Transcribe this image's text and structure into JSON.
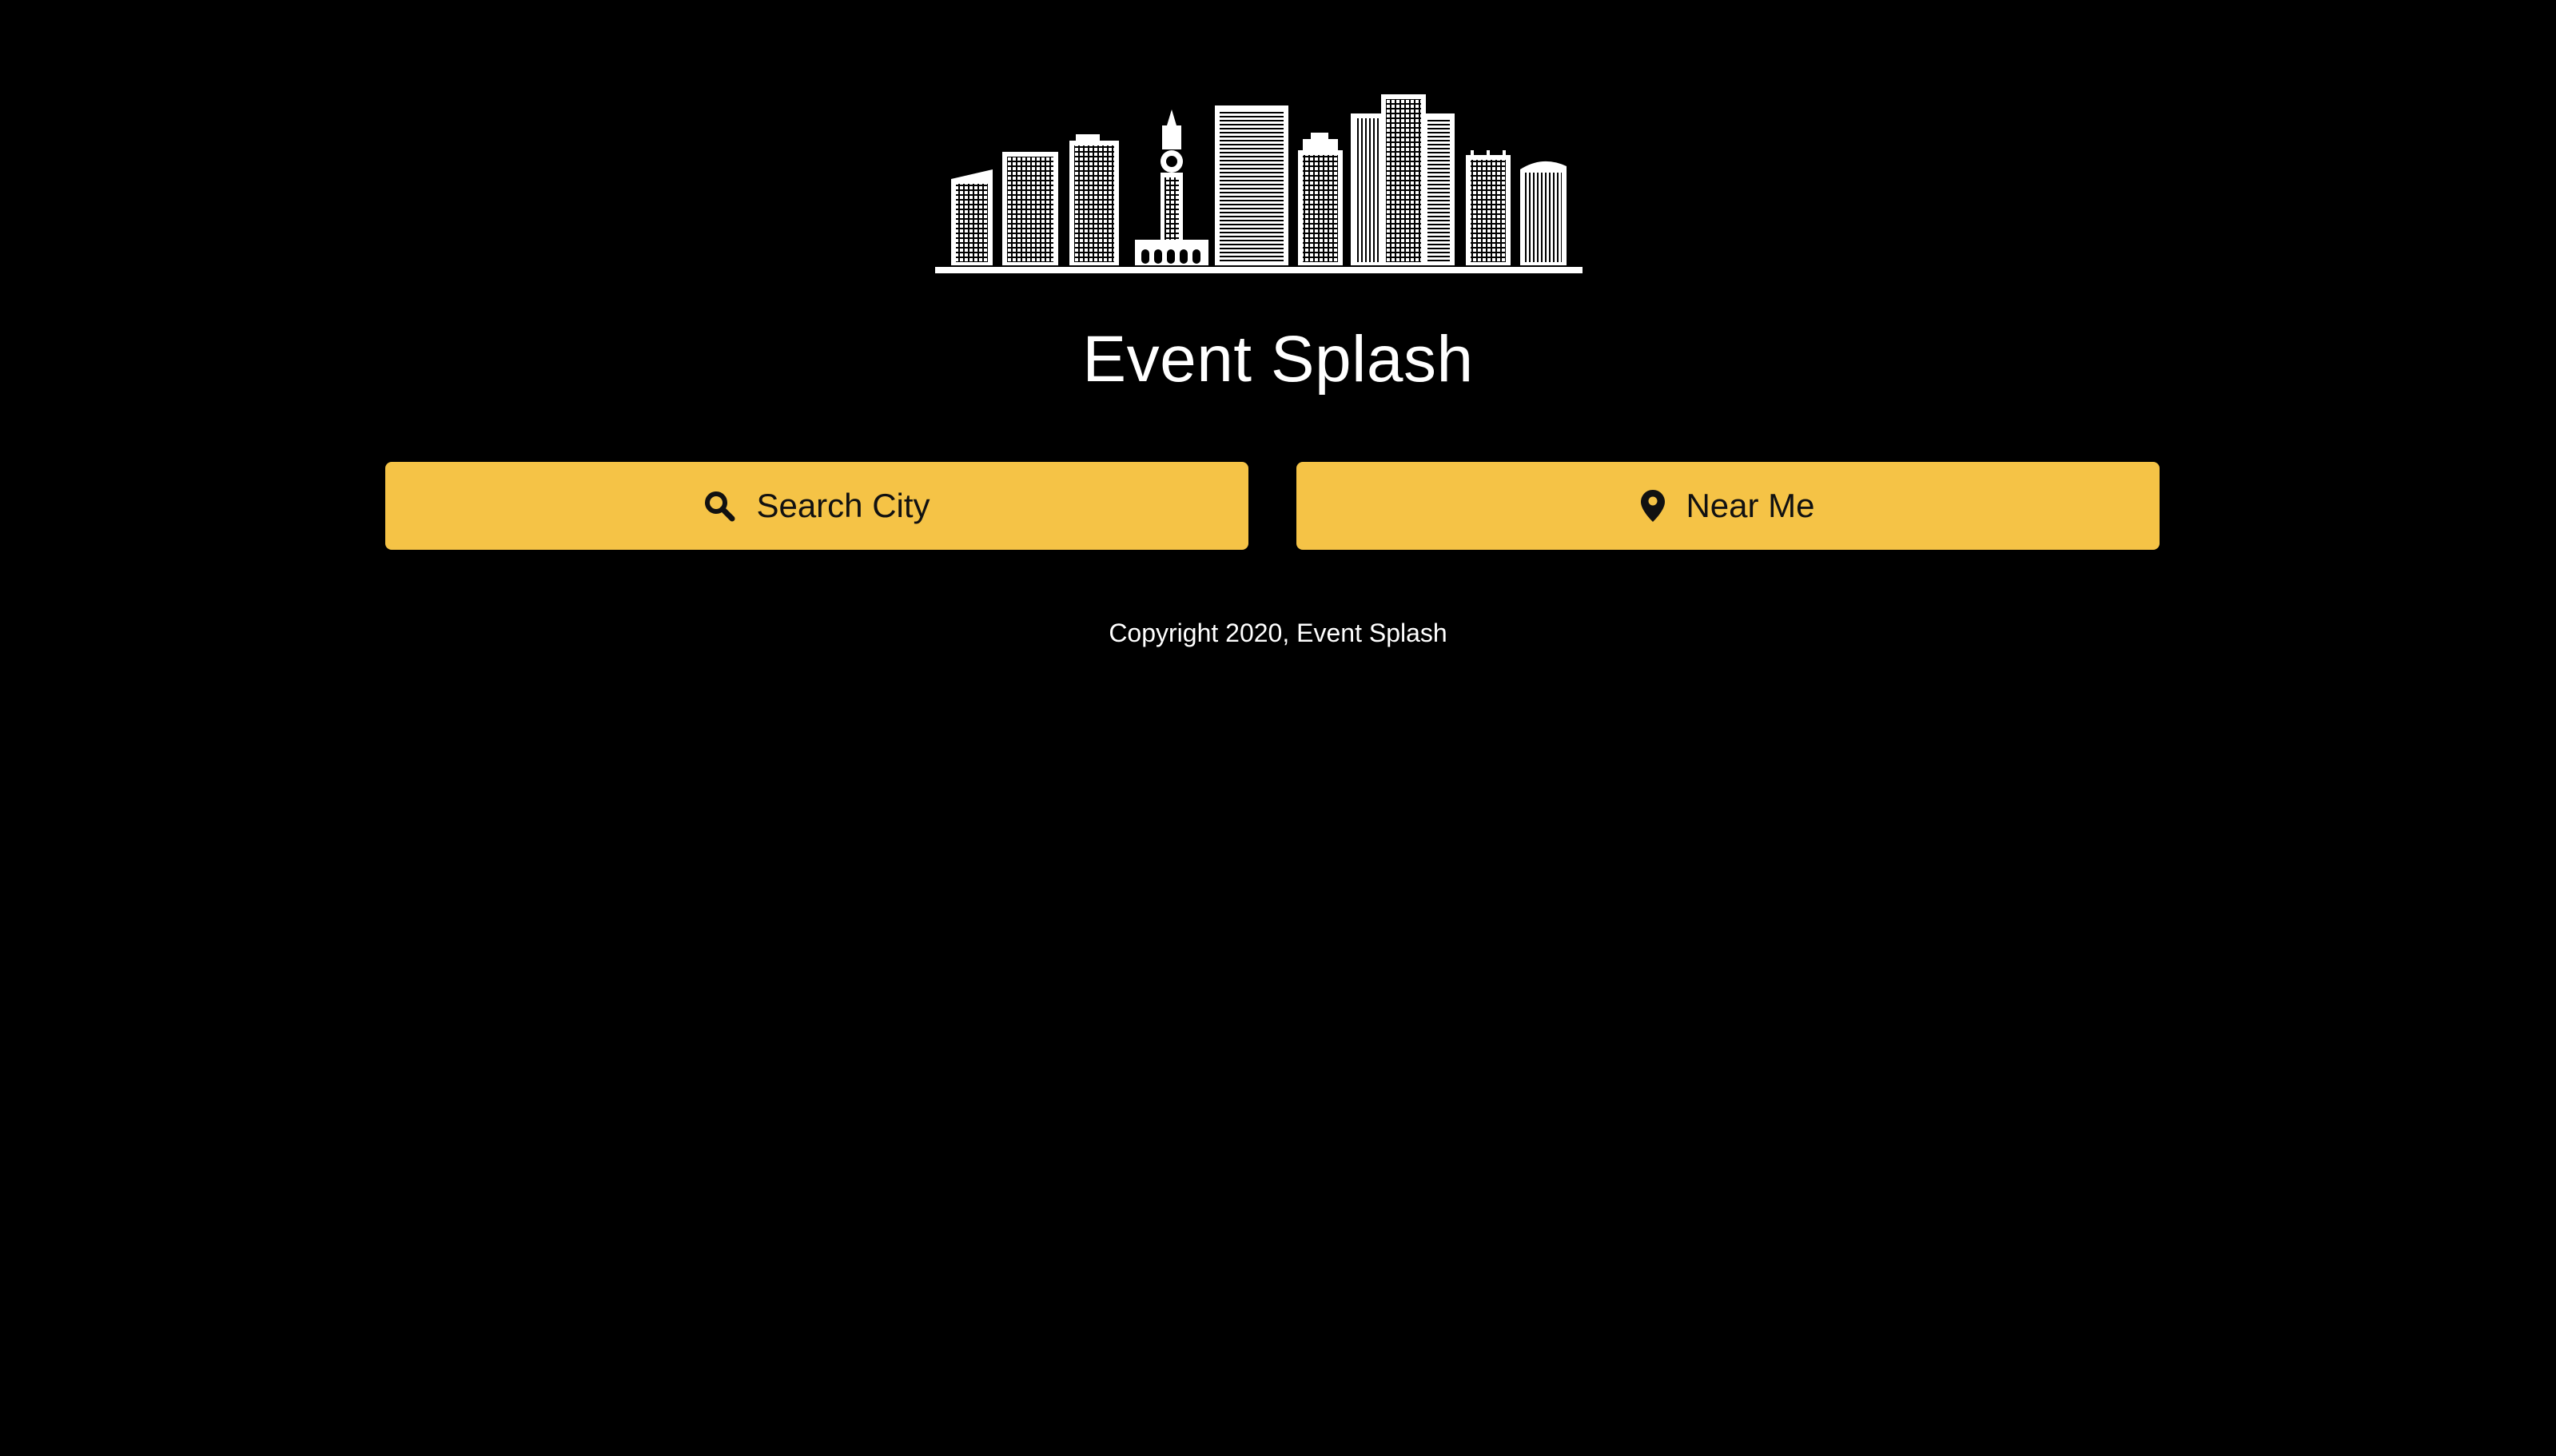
{
  "app": {
    "title": "Event Splash"
  },
  "logo": {
    "icon": "city-skyline-icon"
  },
  "buttons": {
    "search_city": {
      "label": "Search City",
      "icon": "search-icon"
    },
    "near_me": {
      "label": "Near Me",
      "icon": "map-marker-icon"
    }
  },
  "footer": {
    "copyright": "Copyright 2020, Event Splash"
  },
  "colors": {
    "background": "#000000",
    "button": "#f5c346",
    "text": "#ffffff"
  }
}
